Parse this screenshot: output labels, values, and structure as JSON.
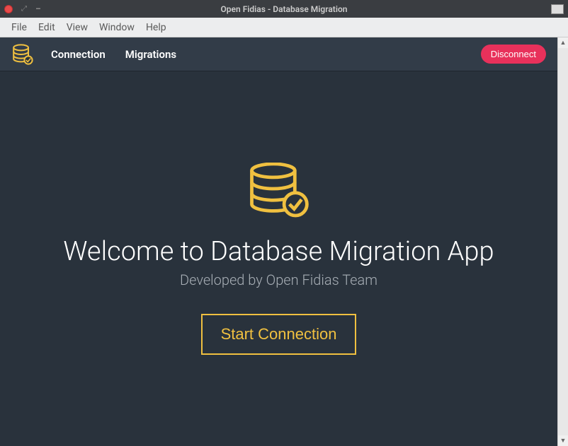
{
  "window": {
    "title": "Open Fidias - Database Migration"
  },
  "menubar": {
    "items": [
      "File",
      "Edit",
      "View",
      "Window",
      "Help"
    ]
  },
  "header": {
    "tabs": [
      "Connection",
      "Migrations"
    ],
    "disconnect_label": "Disconnect"
  },
  "hero": {
    "title": "Welcome to Database Migration App",
    "subtitle": "Developed by Open Fidias Team",
    "start_button": "Start Connection"
  },
  "colors": {
    "accent": "#f0c040",
    "danger": "#e8315b",
    "bg_dark": "#29323c",
    "bg_header": "#323c48"
  }
}
